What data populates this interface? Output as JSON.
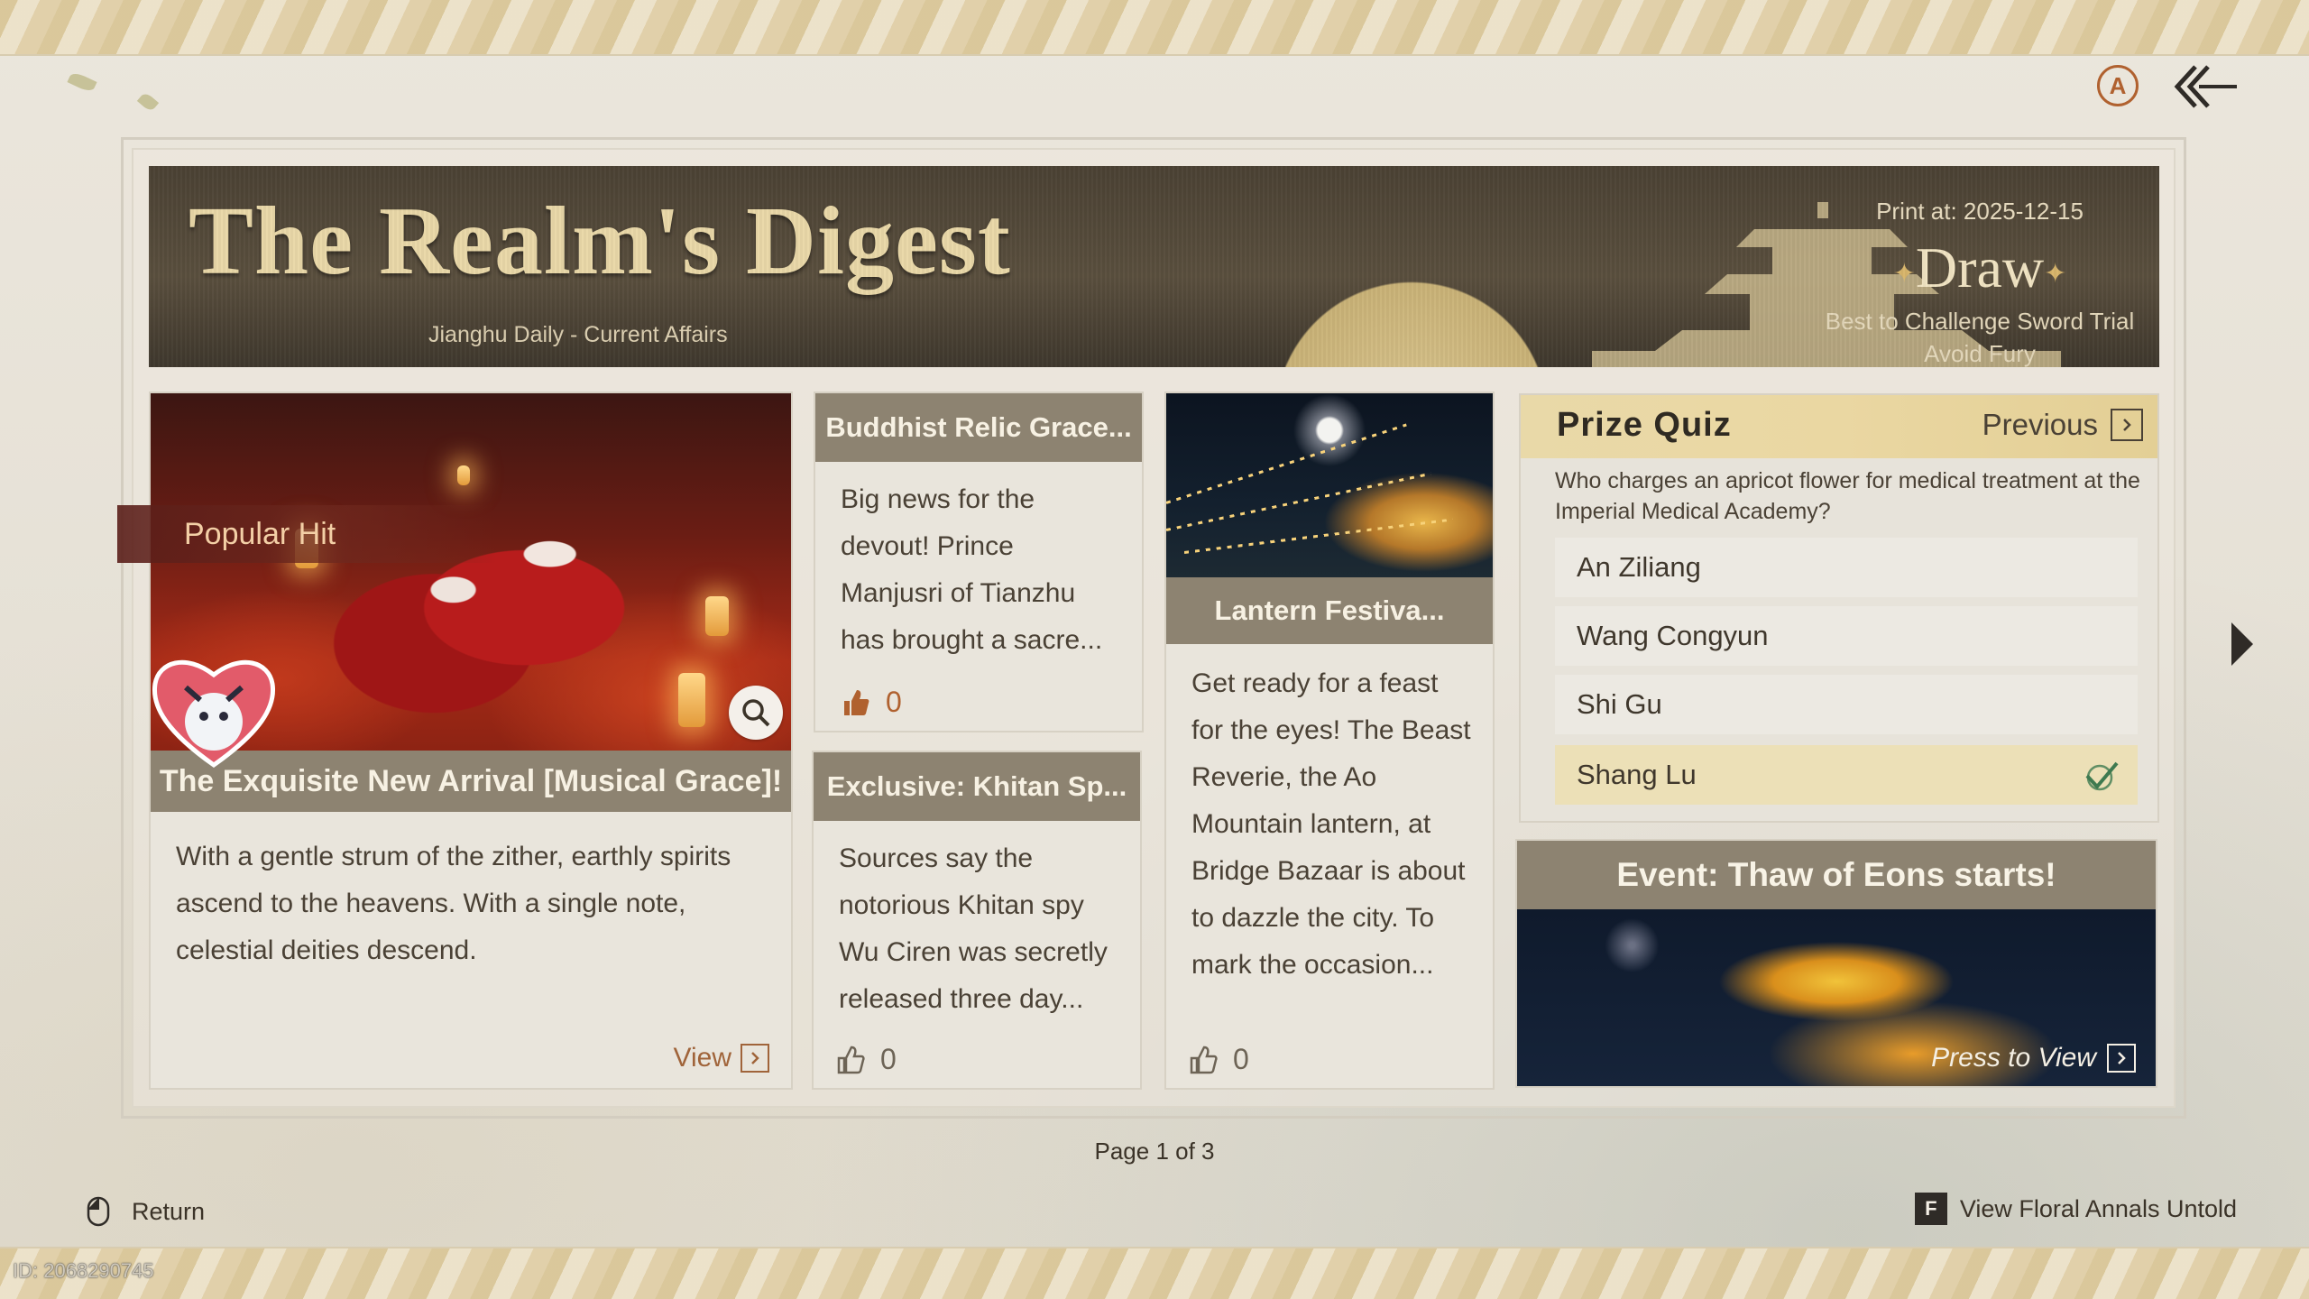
{
  "header_icons": {
    "auto": "A",
    "auto_icon": "auto-icon",
    "back_icon": "back-arrow-icon"
  },
  "banner": {
    "title": "The Realm's Digest",
    "subtitle": "Jianghu Daily - Current Affairs",
    "print_at": "Print at: 2025-12-15",
    "fortune": "Draw",
    "tip_line1": "Best to Challenge Sword Trial",
    "tip_line2": "Avoid Fury"
  },
  "featured": {
    "badge": "Popular Hit",
    "headline": "The Exquisite New Arrival [Musical Grace]!",
    "body": "With a gentle strum of the zither, earthly spirits ascend to the heavens. With a single note, celestial deities descend.",
    "view_label": "View"
  },
  "articles": [
    {
      "title": "Buddhist Relic Grace...",
      "body": "Big news for the devout! Prince Manjusri of Tianzhu has brought a sacre...",
      "likes": "0"
    },
    {
      "title": "Exclusive: Khitan Sp...",
      "body": "Sources say the notorious Khitan spy Wu Ciren was secretly released three day...",
      "likes": "0"
    },
    {
      "title": "Lantern Festiva...",
      "body": "Get ready for a feast for the eyes! The Beast Reverie, the Ao Mountain lantern, at Bridge Bazaar is about to dazzle the city. To mark the occasion...",
      "likes": "0"
    }
  ],
  "quiz": {
    "title": "Prize Quiz",
    "previous_label": "Previous",
    "question": "Who charges an apricot flower for medical treatment at the Imperial Medical Academy?",
    "options": [
      "An Ziliang",
      "Wang Congyun",
      "Shi Gu",
      "Shang Lu"
    ],
    "selected": "Shang Lu"
  },
  "event": {
    "title": "Event: Thaw of Eons starts!",
    "press_label": "Press to View"
  },
  "pagination": "Page 1 of 3",
  "footer": {
    "return_label": "Return",
    "key": "F",
    "annals_label": "View Floral Annals Untold",
    "uid": "ID: 2068290745"
  },
  "colors": {
    "accent_gold": "#e9d8a8",
    "header_brown": "#8d8371",
    "link_orange": "#a0643a",
    "quiz_highlight": "#ece0b7"
  }
}
